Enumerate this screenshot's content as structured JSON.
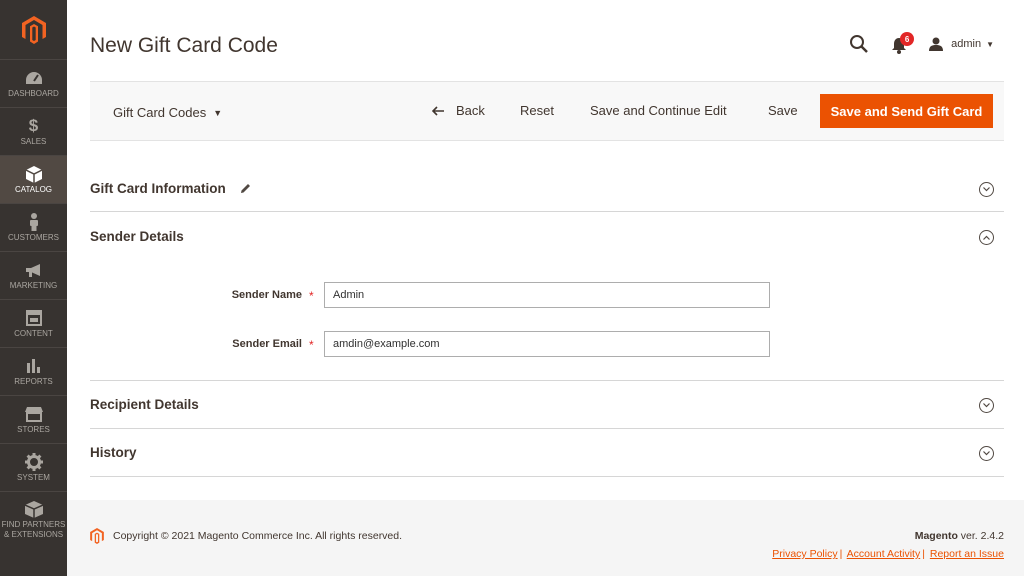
{
  "sidebar": {
    "items": [
      {
        "label": "DASHBOARD",
        "icon": "dashboard-icon"
      },
      {
        "label": "SALES",
        "icon": "dollar-icon"
      },
      {
        "label": "CATALOG",
        "icon": "cube-icon",
        "active": true
      },
      {
        "label": "CUSTOMERS",
        "icon": "person-icon"
      },
      {
        "label": "MARKETING",
        "icon": "megaphone-icon"
      },
      {
        "label": "CONTENT",
        "icon": "layout-icon"
      },
      {
        "label": "REPORTS",
        "icon": "bar-chart-icon"
      },
      {
        "label": "STORES",
        "icon": "storefront-icon"
      },
      {
        "label": "SYSTEM",
        "icon": "gear-icon"
      },
      {
        "label_line1": "FIND PARTNERS",
        "label_line2": "& EXTENSIONS",
        "icon": "box-icon"
      }
    ]
  },
  "header": {
    "title": "New Gift Card Code",
    "notifications_count": "6",
    "user": "admin"
  },
  "toolbar": {
    "store_switcher": "Gift Card Codes",
    "back": "Back",
    "reset": "Reset",
    "save_continue": "Save and Continue Edit",
    "save": "Save",
    "save_send": "Save and Send Gift Card"
  },
  "sections": {
    "gift_card_info": "Gift Card Information",
    "sender_details": "Sender Details",
    "recipient_details": "Recipient Details",
    "history": "History"
  },
  "sender": {
    "name_label": "Sender Name",
    "name_value": "Admin",
    "email_label": "Sender Email",
    "email_value": "amdin@example.com"
  },
  "footer": {
    "copyright": "Copyright © 2021 Magento Commerce Inc. All rights reserved.",
    "brand": "Magento",
    "version": " ver. 2.4.2",
    "links": [
      "Privacy Policy",
      "Account Activity",
      "Report an Issue"
    ]
  },
  "colors": {
    "accent": "#eb5202",
    "sidebar_bg": "#373330",
    "sidebar_active": "#514943"
  }
}
